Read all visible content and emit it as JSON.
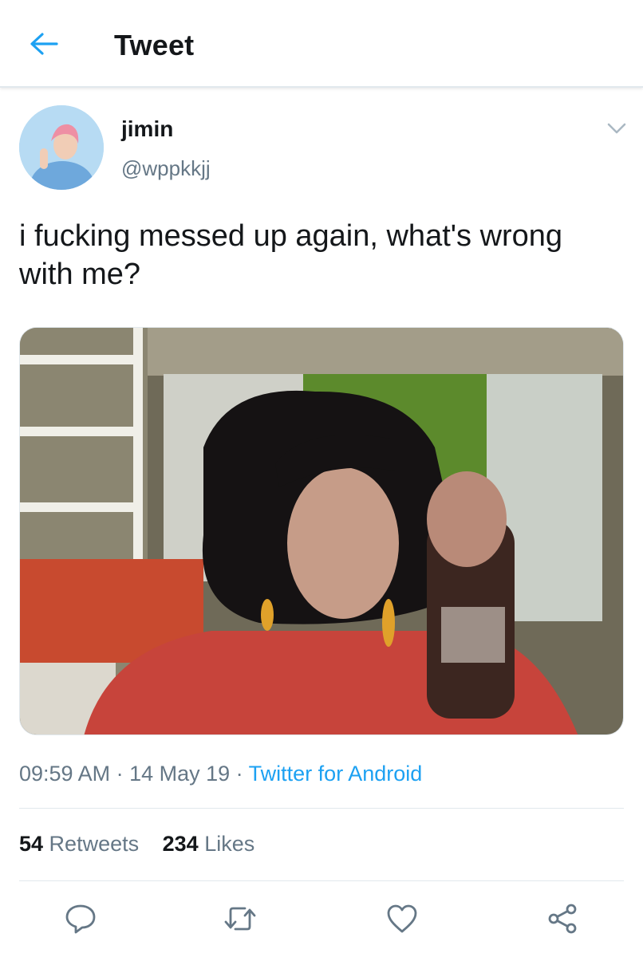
{
  "header": {
    "title": "Tweet",
    "back_icon": "arrow-left-icon"
  },
  "tweet": {
    "author": {
      "display_name": "jimin",
      "handle": "@wppkkjj"
    },
    "text": "i fucking messed up again, what's wrong with me?",
    "meta": {
      "time": "09:59 AM",
      "separator": " · ",
      "date": "14 May 19",
      "source": "Twitter for Android"
    },
    "stats": {
      "retweets_count": "54",
      "retweets_label": " Retweets",
      "likes_count": "234",
      "likes_label": " Likes"
    }
  },
  "actions": [
    "reply-icon",
    "retweet-icon",
    "like-icon",
    "share-icon"
  ],
  "colors": {
    "accent": "#1da1f2",
    "secondary_text": "#657786",
    "primary_text": "#14171a",
    "divider": "#e1e8ed"
  }
}
